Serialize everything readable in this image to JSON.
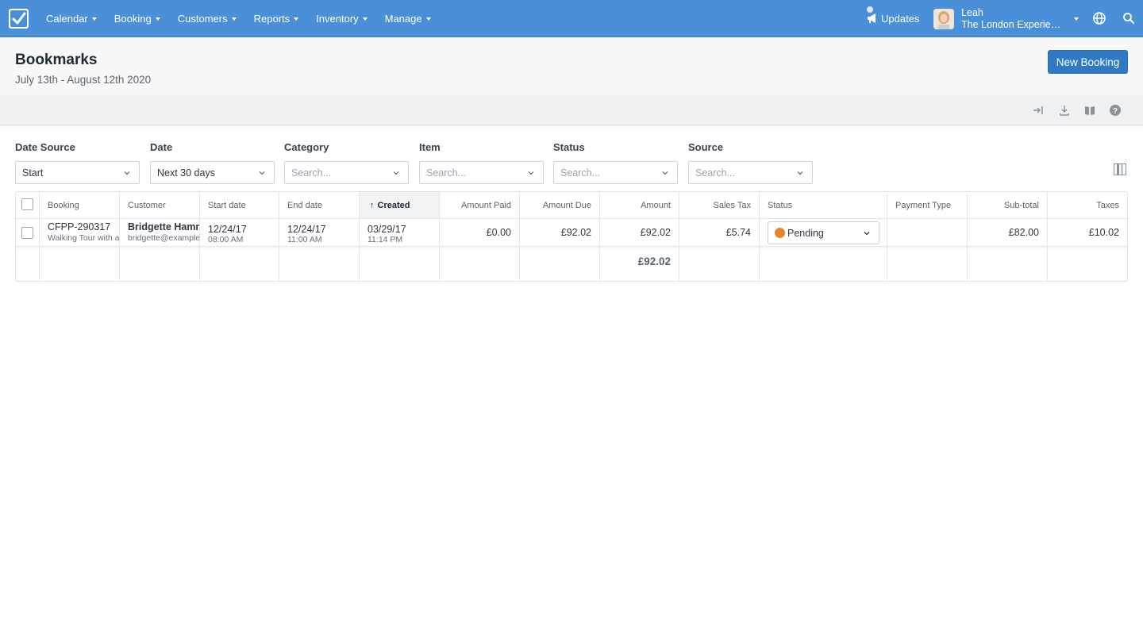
{
  "nav": {
    "items": [
      "Calendar",
      "Booking",
      "Customers",
      "Reports",
      "Inventory",
      "Manage"
    ],
    "updates_label": "Updates",
    "user_name": "Leah",
    "user_org": "The London Experience Company"
  },
  "header": {
    "title": "Bookmarks",
    "subtitle": "July 13th - August 12th 2020",
    "new_booking_label": "New Booking"
  },
  "filters": [
    {
      "label": "Date Source",
      "value": "Start",
      "placeholder": false
    },
    {
      "label": "Date",
      "value": "Next 30 days",
      "placeholder": false
    },
    {
      "label": "Category",
      "value": "Search...",
      "placeholder": true
    },
    {
      "label": "Item",
      "value": "Search...",
      "placeholder": true
    },
    {
      "label": "Status",
      "value": "Search...",
      "placeholder": true
    },
    {
      "label": "Source",
      "value": "Search...",
      "placeholder": true
    }
  ],
  "table": {
    "columns": [
      "Booking",
      "Customer",
      "Start date",
      "End date",
      "Created",
      "Amount Paid",
      "Amount Due",
      "Amount",
      "Sales Tax",
      "Status",
      "Payment Type",
      "Sub-total",
      "Taxes"
    ],
    "sorted_indicator": "↑",
    "rows": [
      {
        "booking_id": "CFPP-290317",
        "booking_item": "Walking Tour with a Guide",
        "customer_name": "Bridgette Hammond",
        "customer_email": "bridgette@example.com",
        "start_date": "12/24/17",
        "start_time": "08:00 AM",
        "end_date": "12/24/17",
        "end_time": "11:00 AM",
        "created_date": "03/29/17",
        "created_time": "11:14 PM",
        "amount_paid": "£0.00",
        "amount_due": "£92.02",
        "amount": "£92.02",
        "sales_tax": "£5.74",
        "status": "Pending",
        "status_color": "#e8832a",
        "payment_type": "",
        "subtotal": "£82.00",
        "taxes": "£10.02"
      }
    ],
    "total_amount": "£92.02"
  },
  "colors": {
    "nav_bg": "#4a90d9",
    "primary_button": "#2f78c4",
    "pending": "#e8832a"
  }
}
